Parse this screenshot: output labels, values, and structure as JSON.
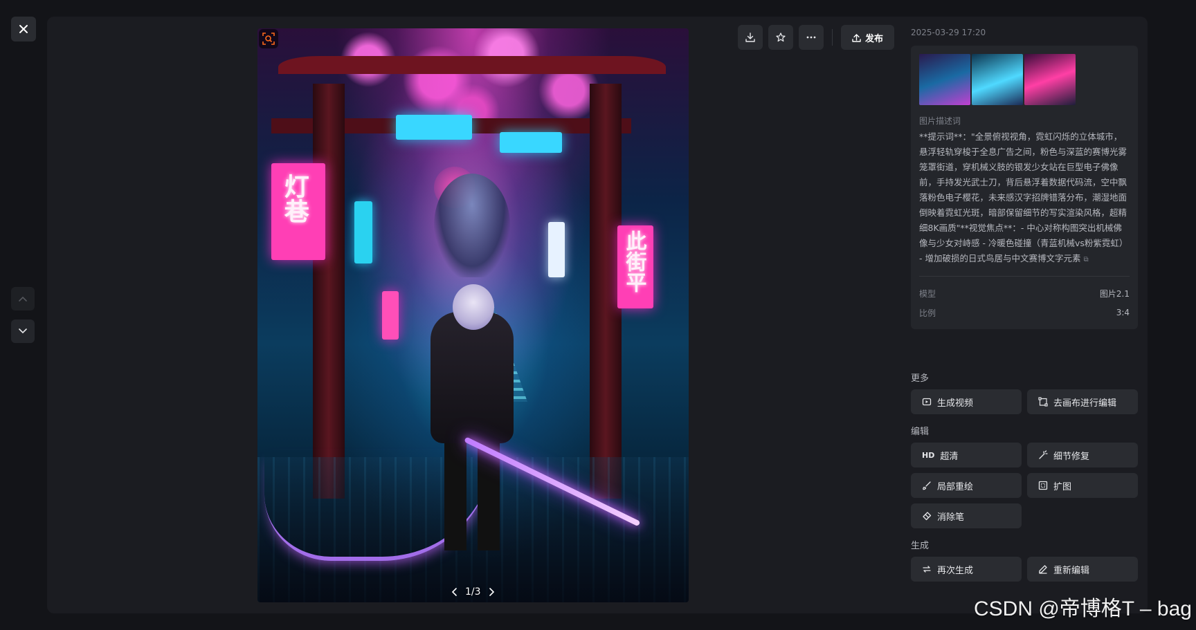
{
  "viewer": {
    "pager": "1/3"
  },
  "toolbar": {
    "publish_label": "发布"
  },
  "info": {
    "timestamp": "2025-03-29 17:20",
    "desc_label": "图片描述词",
    "desc_text": "**提示词**：\"全景俯视视角，霓虹闪烁的立体城市，悬浮轻轨穿梭于全息广告之间，粉色与深蓝的赛博光雾笼罩街道，穿机械义肢的银发少女站在巨型电子佛像前，手持发光武士刀，背后悬浮着数据代码流，空中飘落粉色电子樱花，未来感汉字招牌错落分布，潮湿地面倒映着霓虹光斑，暗部保留细节的写实渲染风格，超精细8K画质\"**视觉焦点**：- 中心对称构图突出机械佛像与少女对峙感 - 冷暖色碰撞（青蓝机械vs粉紫霓虹） - 增加破损的日式鸟居与中文赛博文字元素",
    "model_label": "模型",
    "model_value": "图片2.1",
    "ratio_label": "比例",
    "ratio_value": "3:4"
  },
  "sections": {
    "more_title": "更多",
    "more_buttons": [
      "生成视频",
      "去画布进行编辑"
    ],
    "edit_title": "编辑",
    "edit_buttons": [
      "超清",
      "细节修复",
      "局部重绘",
      "扩图",
      "消除笔"
    ],
    "hd_glyph": "HD",
    "generate_title": "生成",
    "generate_buttons": [
      "再次生成",
      "重新编辑"
    ]
  },
  "image_signs": {
    "left": "灯巷",
    "right": "此街平"
  },
  "watermark": "CSDN @帝博格T – bag",
  "colors": {
    "background": "#131418",
    "panel": "#1b1c21",
    "button": "#2a2c31",
    "neon_pink": "#ff3fb5",
    "neon_cyan": "#39d7ff",
    "lens_orange": "#ff6a1a"
  }
}
